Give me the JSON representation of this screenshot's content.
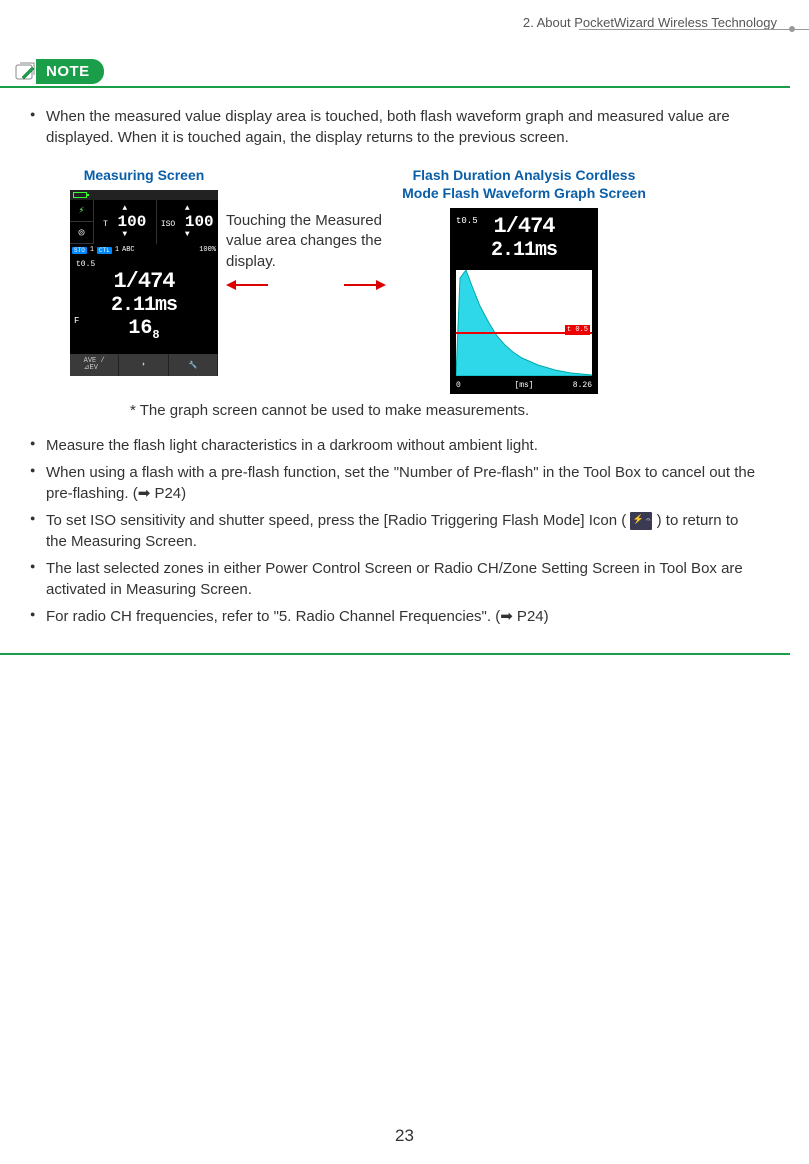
{
  "header": {
    "chapter": "2.  About PocketWizard Wireless Technology"
  },
  "note": {
    "label": "NOTE",
    "bullet1": "When the measured value display area is touched, both flash waveform graph and measured value are displayed. When it is touched again, the display returns to the previous screen.",
    "measuring_title": "Measuring Screen",
    "graph_title": "Flash Duration Analysis Cordless Mode Flash Waveform Graph Screen",
    "middle_text": "Touching the Measured value area changes the display.",
    "graph_footnote": "* The graph screen cannot be used to make measurements.",
    "bullet2": "Measure the flash light characteristics in a darkroom without ambient light.",
    "bullet3": "When using a flash with a pre-flash function, set the \"Number of Pre-flash\" in the Tool Box to cancel out the pre-flashing. (➡ P24)",
    "bullet4a": "To set ISO sensitivity and shutter speed, press the [Radio Triggering Flash Mode] Icon ( ",
    "bullet4b": " ) to return to the Measuring Screen.",
    "bullet5": "The last selected zones in either Power Control Screen or Radio CH/Zone Setting Screen in Tool Box are activated in Measuring Screen.",
    "bullet6": "For radio CH frequencies, refer to \"5. Radio Channel Frequencies\". (➡ P24)"
  },
  "measuring_screen": {
    "t_label": "T",
    "t_value": "100",
    "iso_label": "ISO",
    "iso_value": "100",
    "status": {
      "sto": "STO",
      "num1": "1",
      "ctl": "CTL",
      "num2": "1",
      "abc": "ABC",
      "pct": "100%"
    },
    "t05": "t0.5",
    "fraction": "1/474",
    "ms": "2.11ms",
    "f_label": "F",
    "aperture": "16",
    "aperture_sub": "8",
    "bottom": {
      "ave": "AVE /\n⊿EV",
      "dome": "◗",
      "wrench": "🔧"
    }
  },
  "graph_screen": {
    "t05": "t0.5",
    "fraction": "1/474",
    "ms": "2.11ms",
    "redlabel": "t 0.5",
    "x_min": "0",
    "x_max": "8.26",
    "x_unit": "[ms]"
  },
  "chart_data": {
    "type": "area",
    "title": "Flash Waveform",
    "xlabel": "[ms]",
    "ylabel": "",
    "xlim": [
      0,
      8.26
    ],
    "ylim": [
      0,
      1
    ],
    "x": [
      0,
      0.3,
      0.6,
      1.0,
      1.5,
      2.0,
      2.5,
      3.0,
      3.5,
      4.0,
      5.0,
      6.0,
      7.0,
      8.26
    ],
    "values": [
      0,
      0.95,
      1.0,
      0.85,
      0.66,
      0.5,
      0.38,
      0.29,
      0.22,
      0.17,
      0.1,
      0.06,
      0.03,
      0.01
    ],
    "threshold_line": 0.42
  },
  "page_number": "23"
}
